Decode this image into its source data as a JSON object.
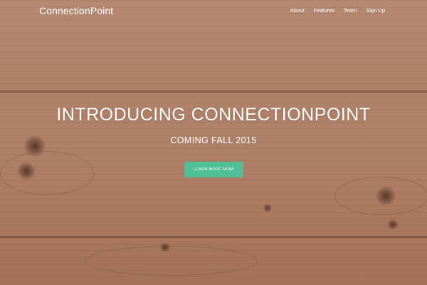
{
  "navbar": {
    "brand": "ConnectionPoint",
    "links": [
      {
        "label": "About"
      },
      {
        "label": "Features"
      },
      {
        "label": "Team"
      },
      {
        "label": "Sign Up"
      }
    ]
  },
  "hero": {
    "title": "INTRODUCING CONNECTIONPOINT",
    "subtitle": "COMING FALL 2015",
    "cta_label": "LEARN MORE NOW!",
    "background": "wood-plank-texture"
  },
  "colors": {
    "cta": "#4fbf98",
    "text": "#ffffff",
    "wood": "#ad7f66"
  }
}
